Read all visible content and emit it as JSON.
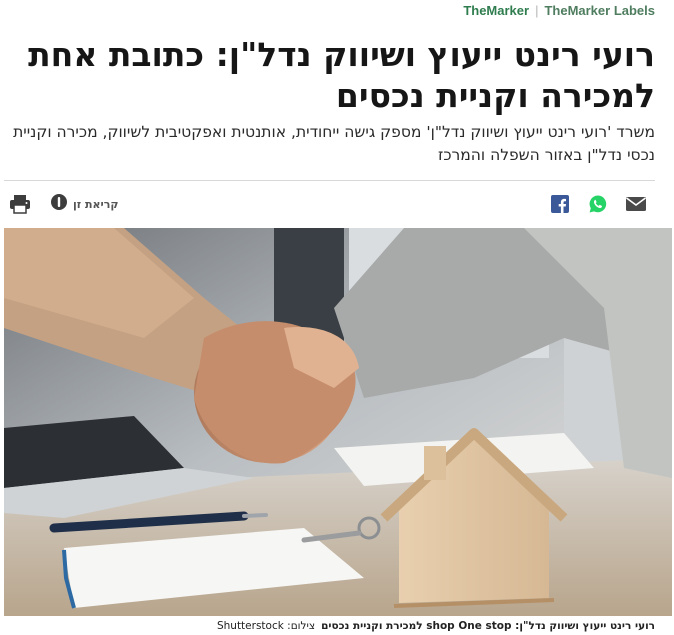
{
  "brand": {
    "primary": "TheMarker",
    "secondary": "TheMarker Labels",
    "color_primary": "#2f7d4f"
  },
  "article": {
    "headline": "רועי רינט ייעוץ ושיווק נדל\"ן: כתובת אחת למכירה וקניית נכסים",
    "subheadline": "משרד 'רועי רינט ייעוץ ושיווק נדל\"ן' מספק גישה ייחודית, אותנטית ואפקטיבית לשיווק, מכירה וקניית נכסי נדל\"ן באזור השפלה והמרכז"
  },
  "toolbar": {
    "reading_mode_label": "קריאת זן",
    "icons": [
      "facebook-icon",
      "whatsapp-icon",
      "mail-icon",
      "print-icon",
      "reading-mode-icon"
    ],
    "facebook_color": "#3b5998",
    "whatsapp_color": "#25d366"
  },
  "image": {
    "description_icon": "handshake-house-photo",
    "caption_title": "רועי רינט ייעוץ ושיווק נדל\"ן: shop One stop למכירת וקניית נכסים",
    "credit": "צילום: Shutterstock"
  }
}
